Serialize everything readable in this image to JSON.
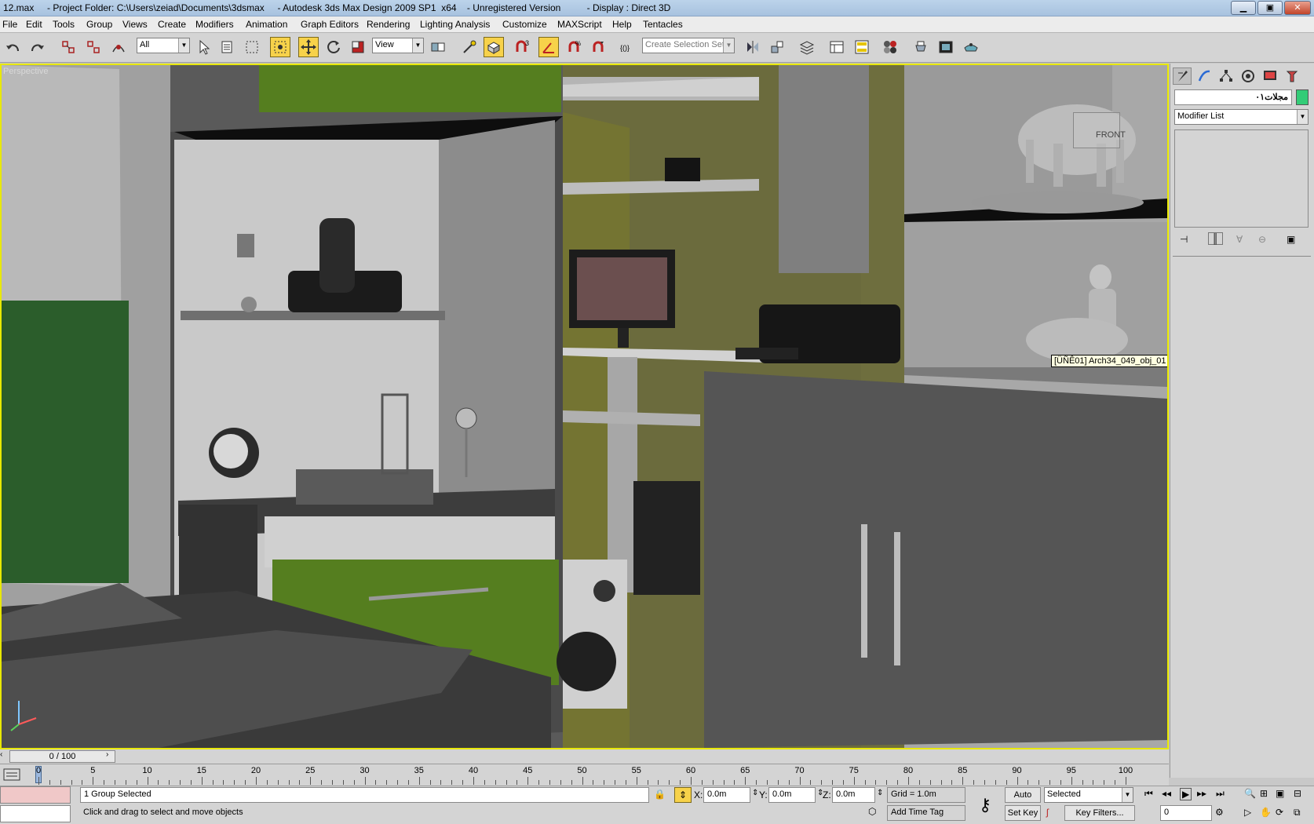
{
  "window": {
    "title": "12.max     - Project Folder: C:\\Users\\zeiad\\Documents\\3dsmax     - Autodesk 3ds Max Design 2009 SP1  x64    - Unregistered Version          - Display : Direct 3D"
  },
  "menu": {
    "items": [
      "File",
      "Edit",
      "Tools",
      "Group",
      "Views",
      "Create",
      "Modifiers",
      "Animation",
      "Graph Editors",
      "Rendering",
      "Lighting Analysis",
      "Customize",
      "MAXScript",
      "Help",
      "Tentacles"
    ]
  },
  "toolbar": {
    "selection_filter": "All",
    "ref_coord": "View",
    "named_selection_placeholder": "Create Selection Set"
  },
  "viewport": {
    "label": "Perspective",
    "tooltip": "[ÜÑÊ01] Arch34_049_obj_01",
    "viewcube_face": "FRONT"
  },
  "command_panel": {
    "object_name": "مجلات٠١",
    "object_color": "#33cc77",
    "modifier_list_label": "Modifier List"
  },
  "timeline": {
    "frame_display": "0 / 100",
    "tick_labels": [
      "0",
      "5",
      "10",
      "15",
      "20",
      "25",
      "30",
      "35",
      "40",
      "45",
      "50",
      "55",
      "60",
      "65",
      "70",
      "75",
      "80",
      "85",
      "90",
      "95",
      "100"
    ]
  },
  "status": {
    "selection_text": "1 Group Selected",
    "prompt_text": "Click and drag to select and move objects",
    "x_label": "X:",
    "x_value": "0.0m",
    "y_label": "Y:",
    "y_value": "0.0m",
    "z_label": "Z:",
    "z_value": "0.0m",
    "grid_text": "Grid = 1.0m",
    "add_time_tag": "Add Time Tag",
    "auto_key": "Auto Key",
    "set_key": "Set Key",
    "key_mode_value": "Selected",
    "key_filters": "Key Filters...",
    "current_frame": "0"
  }
}
